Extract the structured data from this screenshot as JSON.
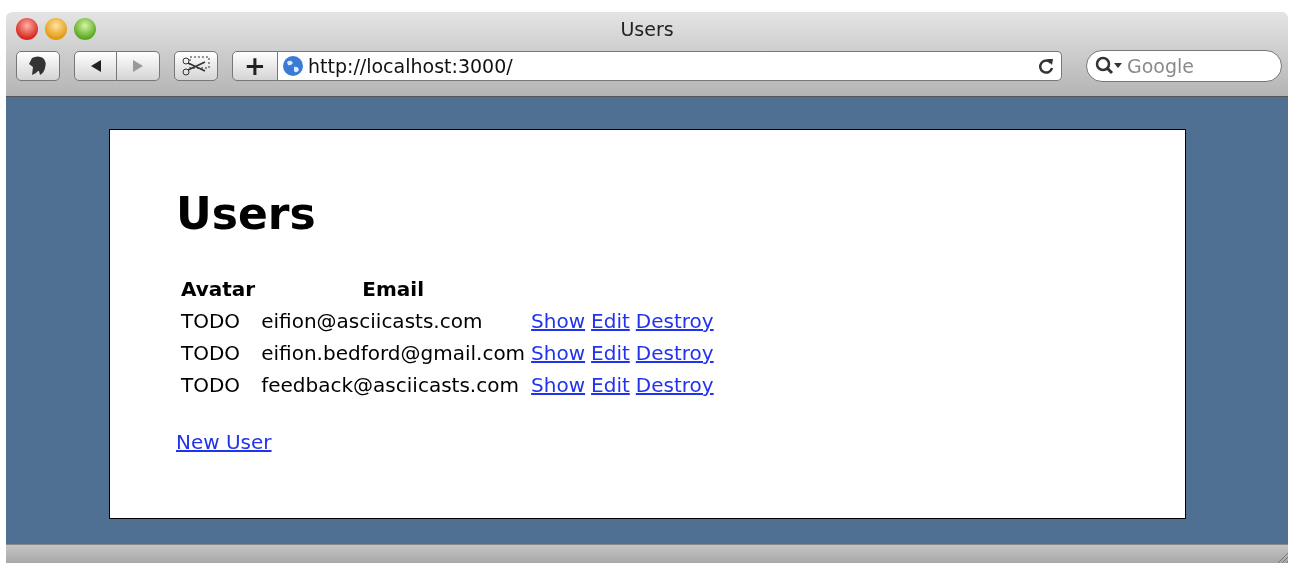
{
  "window": {
    "title": "Users"
  },
  "toolbar": {
    "nav": [
      {
        "kind": "back",
        "disabled": false
      },
      {
        "kind": "forward",
        "disabled": true
      }
    ],
    "add_button": "+",
    "url": "http://localhost:3000/",
    "search_placeholder": "Google"
  },
  "page": {
    "heading": "Users",
    "table": {
      "columns": [
        "Avatar",
        "Email"
      ],
      "rows": [
        {
          "avatar": "TODO",
          "email": "eifion@asciicasts.com",
          "actions": [
            "Show",
            "Edit",
            "Destroy"
          ]
        },
        {
          "avatar": "TODO",
          "email": "eifion.bedford@gmail.com",
          "actions": [
            "Show",
            "Edit",
            "Destroy"
          ]
        },
        {
          "avatar": "TODO",
          "email": "feedback@asciicasts.com",
          "actions": [
            "Show",
            "Edit",
            "Destroy"
          ]
        }
      ]
    },
    "new_link": "New User"
  }
}
